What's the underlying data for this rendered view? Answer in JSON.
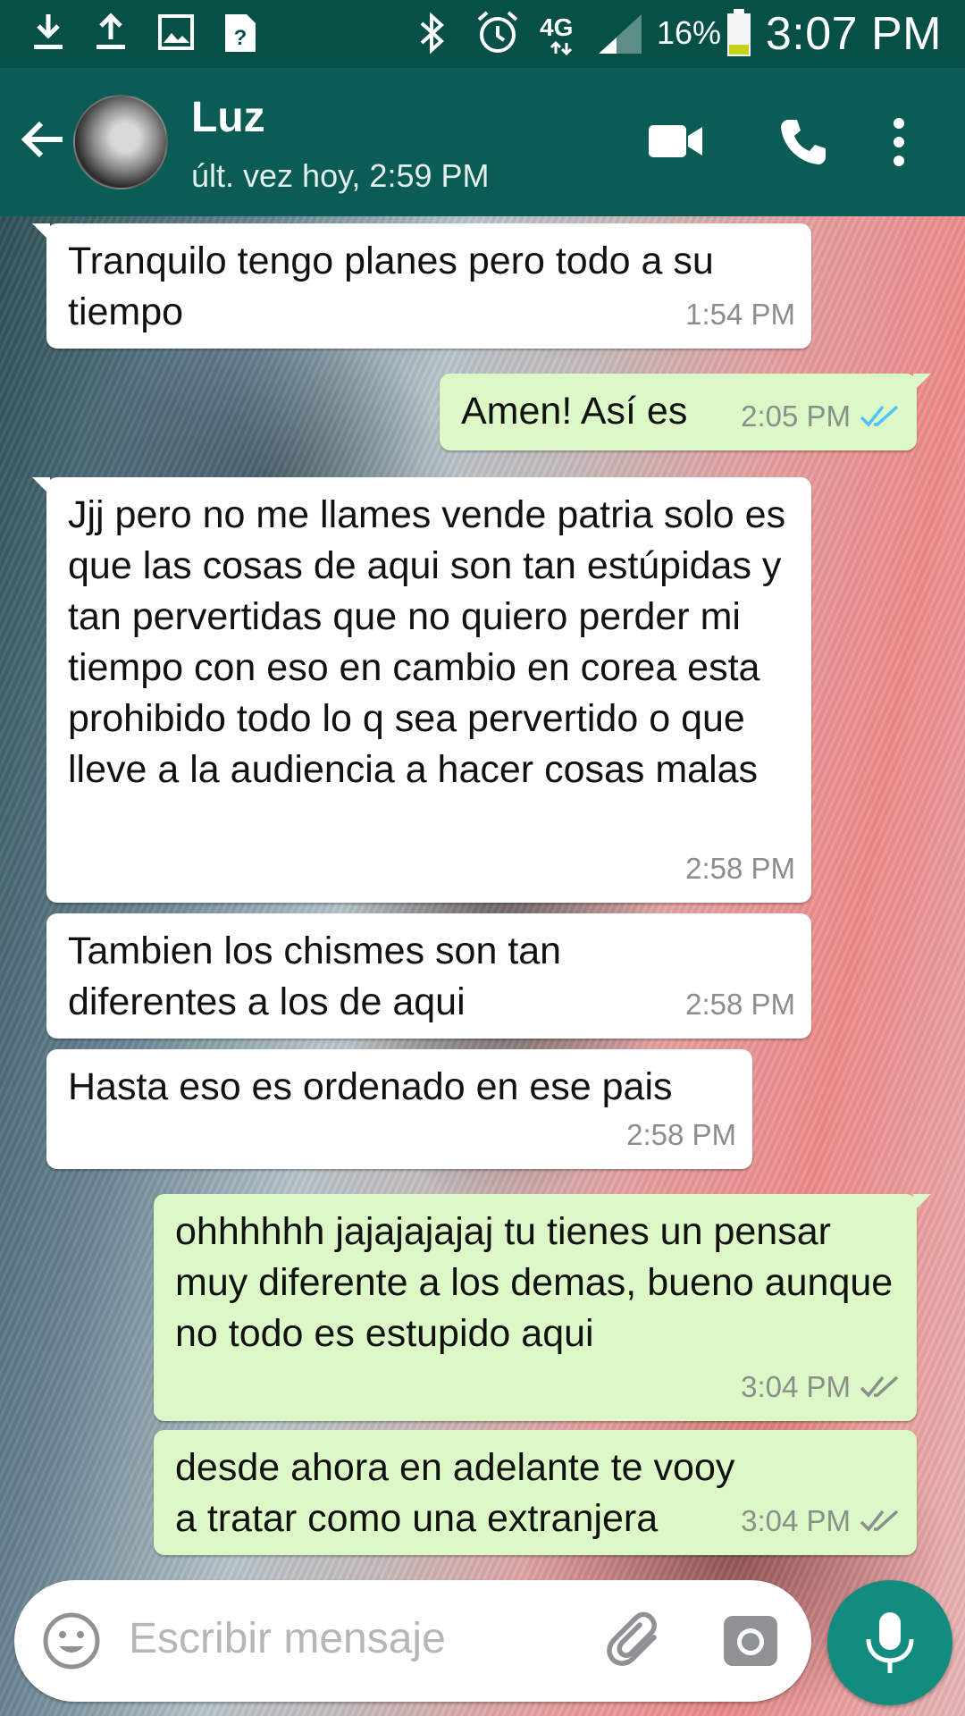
{
  "status_bar": {
    "battery_pct": "16%",
    "time": "3:07 PM",
    "network": "4G"
  },
  "header": {
    "contact_name": "Luz",
    "last_seen": "últ. vez hoy, 2:59 PM"
  },
  "messages": [
    {
      "direction": "in",
      "text": "Tranquilo tengo planes pero todo a su tiempo",
      "time": "1:54 PM"
    },
    {
      "direction": "out",
      "text": "Amen! Así es",
      "time": "2:05 PM",
      "status": "read"
    },
    {
      "direction": "in",
      "text": "Jjj pero no me llames vende patria solo es que las cosas de aqui son tan estúpidas y tan pervertidas que no quiero perder mi tiempo con eso en cambio en corea esta prohibido todo lo q sea pervertido o que lleve a la audiencia a hacer cosas malas",
      "time": "2:58 PM"
    },
    {
      "direction": "in",
      "text": "Tambien los chismes son tan diferentes a los de aqui",
      "time": "2:58 PM"
    },
    {
      "direction": "in",
      "text": "Hasta eso es ordenado en ese pais",
      "time": "2:58 PM"
    },
    {
      "direction": "out",
      "text": "ohhhhhh jajajajajaj tu tienes un pensar muy diferente a los demas, bueno aunque no todo es estupido aqui",
      "time": "3:04 PM",
      "status": "delivered"
    },
    {
      "direction": "out",
      "text": "desde ahora en adelante te vooy a tratar como una extranjera",
      "time": "3:04 PM",
      "status": "delivered"
    }
  ],
  "composer": {
    "placeholder": "Escribir mensaje"
  },
  "colors": {
    "header": "#0b5c54",
    "status_bar": "#075048",
    "incoming_bubble": "#ffffff",
    "outgoing_bubble": "#dcf8c6",
    "read_ticks": "#4fc3f7",
    "delivered_ticks": "#8a8f8c",
    "mic_button": "#128c7e"
  },
  "icons": {
    "status_left": [
      "download-icon",
      "upload-icon",
      "image-icon",
      "help-file-icon"
    ],
    "status_right": [
      "bluetooth-icon",
      "alarm-icon",
      "4g-lte-icon",
      "signal-icon",
      "battery-icon"
    ],
    "header": [
      "back-arrow-icon",
      "video-call-icon",
      "phone-icon",
      "more-vert-icon"
    ],
    "composer": [
      "emoji-icon",
      "paperclip-icon",
      "camera-icon",
      "mic-icon"
    ]
  }
}
